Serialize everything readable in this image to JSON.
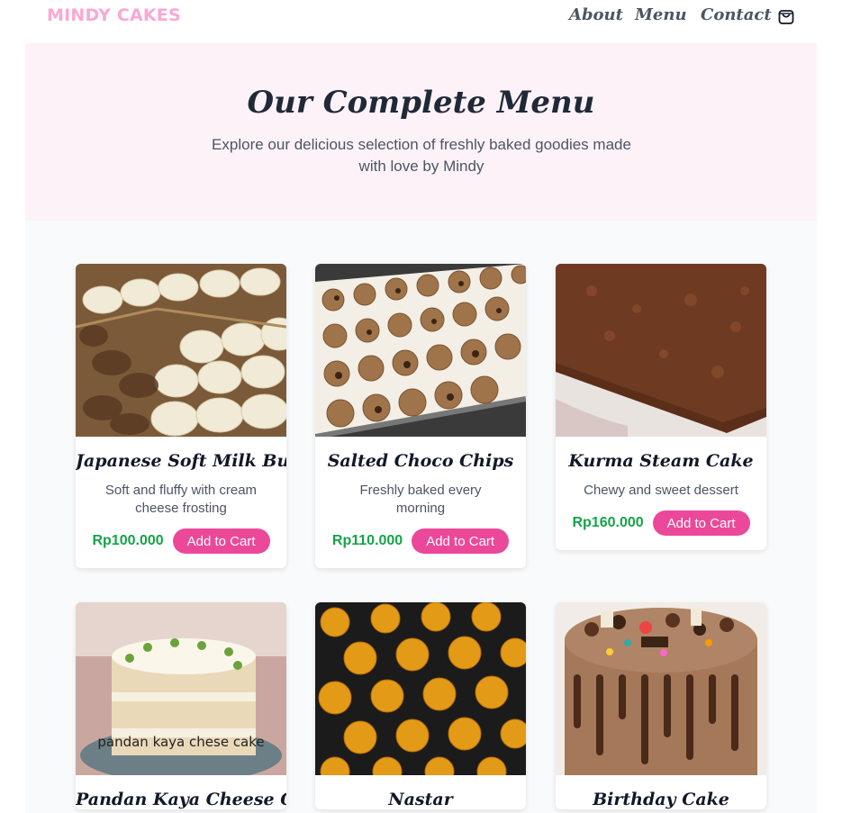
{
  "nav": {
    "brand": "MINDY CAKES",
    "links": [
      "About",
      "Menu",
      "Contact"
    ],
    "cart_icon": "shopping-bag-icon"
  },
  "hero": {
    "title": "Our Complete Menu",
    "subtitle": "Explore our delicious selection of freshly baked goodies made with love by Mindy"
  },
  "products": [
    {
      "name": "Japanese Soft Milk Bun",
      "description": "Soft and fluffy with cream cheese frosting",
      "price": "Rp100.000",
      "button": "Add to Cart"
    },
    {
      "name": "Salted Choco Chips",
      "description": "Freshly baked every morning",
      "price": "Rp110.000",
      "button": "Add to Cart"
    },
    {
      "name": "Kurma Steam Cake",
      "description": "Chewy and sweet dessert",
      "price": "Rp160.000",
      "button": "Add to Cart"
    },
    {
      "name": "Pandan Kaya Cheese Cake",
      "image_caption": "pandan kaya chese cake"
    },
    {
      "name": "Nastar"
    },
    {
      "name": "Birthday Cake"
    }
  ],
  "colors": {
    "brand": "#f9a8d4",
    "hero_bg": "#fdf2f8",
    "main_bg": "#f9fafb",
    "price": "#16a34a",
    "button": "#ec4899"
  }
}
